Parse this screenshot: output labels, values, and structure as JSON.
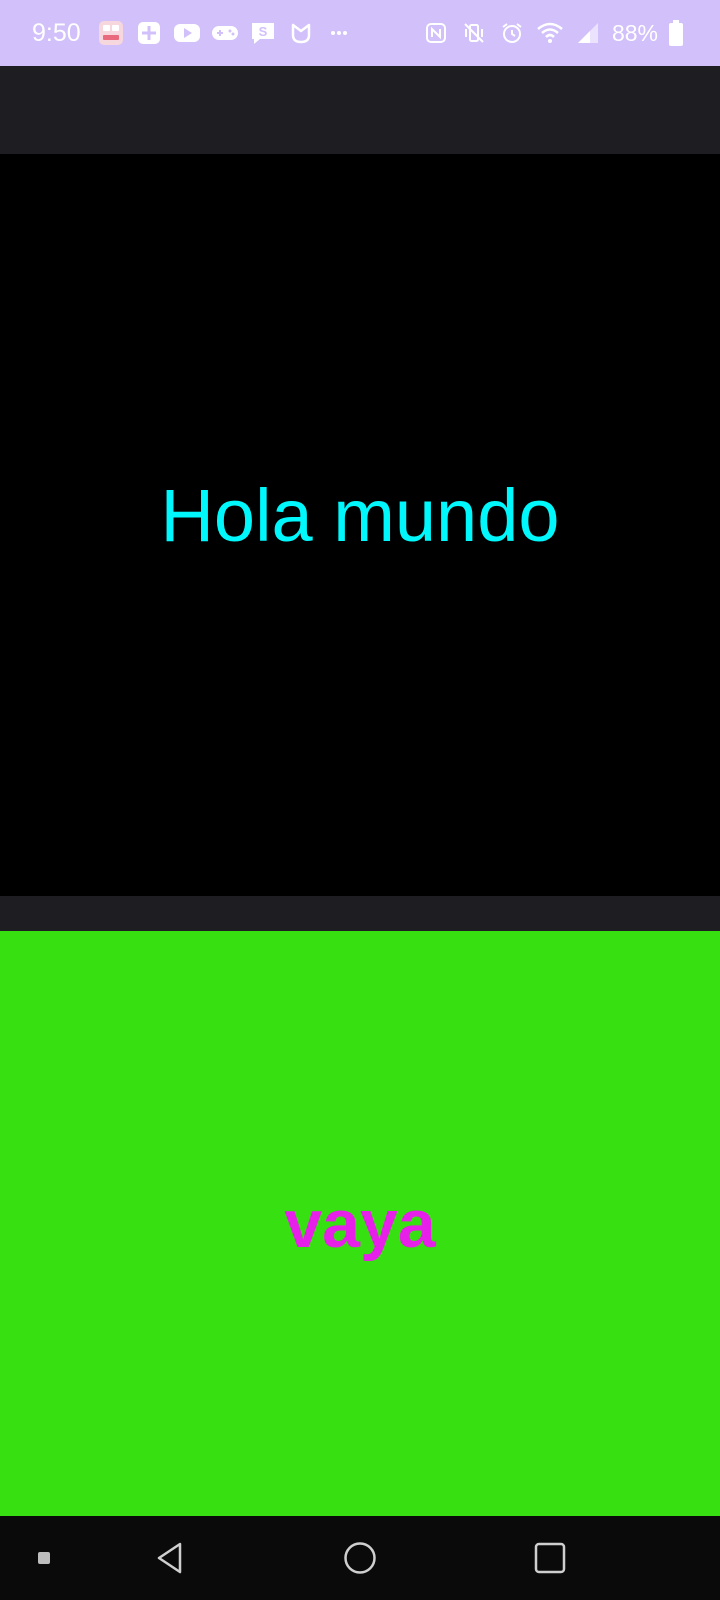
{
  "status_bar": {
    "time": "9:50",
    "battery_percent": "88%",
    "background": "#d2c0fa",
    "left_icons": [
      "calendar-app-icon",
      "plus-app-icon",
      "youtube-icon",
      "gamepad-icon",
      "message-s-icon",
      "mi-icon",
      "more-dots-icon"
    ],
    "right_icons": [
      "nfc-icon",
      "vibrate-mute-icon",
      "alarm-icon",
      "wifi-icon",
      "signal-icon",
      "battery-icon"
    ]
  },
  "main": {
    "top_panel": {
      "text": "Hola mundo",
      "background": "#000000",
      "text_color": "#00f8fc"
    },
    "bottom_panel": {
      "text": "vaya",
      "background": "#37e010",
      "text_color": "#e620e8"
    }
  },
  "nav_bar": {
    "buttons": [
      "menu-square-icon",
      "back-icon",
      "home-icon",
      "recents-icon"
    ]
  },
  "theme": {
    "app_bar_bg": "#1e1e22",
    "nav_bg": "#0a0a0a"
  }
}
